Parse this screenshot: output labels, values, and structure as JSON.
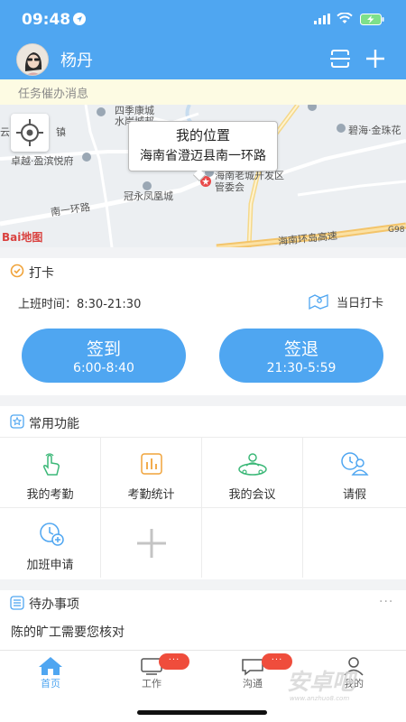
{
  "status_bar": {
    "time": "09:48"
  },
  "header": {
    "user_name": "杨丹"
  },
  "notice": {
    "text": "任务催办消息"
  },
  "map": {
    "bubble_title": "我的位置",
    "bubble_address": "海南省澄迈县南一环路",
    "labels": {
      "l1": "四季康城",
      "l2": "水岸城邦",
      "l3": "镇",
      "l4": "卓越·盈滨悦府",
      "l5": "南一环路",
      "l6": "冠永凤凰城",
      "l7": "海南老城开发区",
      "l8": "管委会",
      "l9": "碧海·金珠花",
      "l10": "海南环岛高速",
      "l11": "G98",
      "l12": "云"
    },
    "logo_text": "Bai地图"
  },
  "clock_in": {
    "title": "打卡",
    "work_time": "上班时间：8:30-21:30",
    "today_label": "当日打卡",
    "sign_in": {
      "label": "签到",
      "time": "6:00-8:40"
    },
    "sign_out": {
      "label": "签退",
      "time": "21:30-5:59"
    }
  },
  "common": {
    "title": "常用功能",
    "items": [
      {
        "label": "我的考勤"
      },
      {
        "label": "考勤统计"
      },
      {
        "label": "我的会议"
      },
      {
        "label": "请假"
      },
      {
        "label": "加班申请"
      }
    ]
  },
  "todo": {
    "title": "待办事项",
    "item": "陈的旷工需要您核对",
    "more": "···"
  },
  "tabbar": {
    "items": [
      {
        "label": "首页",
        "badge": ""
      },
      {
        "label": "工作",
        "badge": "···"
      },
      {
        "label": "沟通",
        "badge": "···"
      },
      {
        "label": "我的",
        "badge": ""
      }
    ],
    "active_color": "#4fa6f1"
  },
  "watermark": {
    "text": "安卓吧",
    "sub": "www.anzhuo8.com"
  },
  "colors": {
    "primary": "#4fa6f1",
    "badge": "#ef4d3c",
    "notice_bg": "#fdfbe3"
  }
}
